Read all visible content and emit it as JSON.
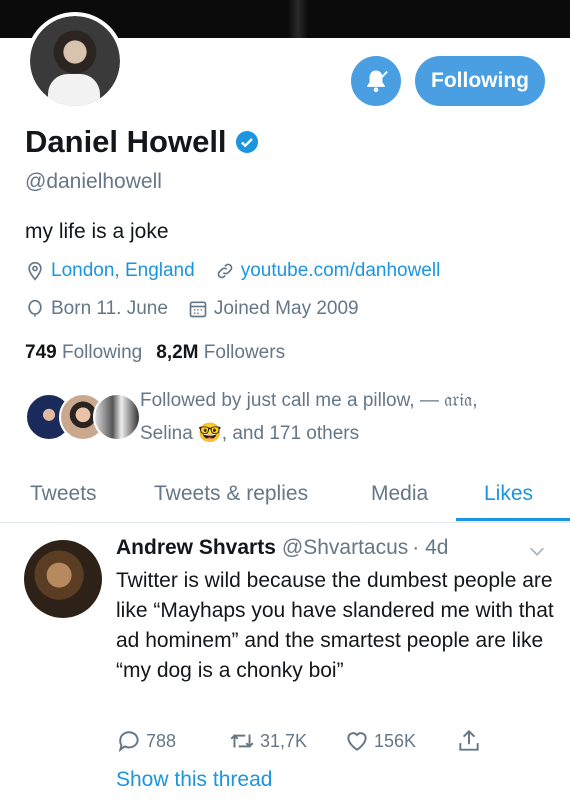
{
  "profile": {
    "name": "Daniel Howell",
    "handle": "@danielhowell",
    "bio": "my life is a joke",
    "location": "London, England",
    "website": "youtube.com/danhowell",
    "born": "Born 11. June",
    "joined": "Joined May 2009"
  },
  "header": {
    "follow_label": "Following"
  },
  "stats": {
    "following_count": "749",
    "following_label": "Following",
    "followers_count": "8,2M",
    "followers_label": "Followers"
  },
  "followed_by": {
    "line1": "Followed by just call me a pillow, — 𝔞𝔯𝔦𝔞,",
    "name": "Selina",
    "emoji": "🤓",
    "rest": ", and 171 others"
  },
  "tabs": [
    {
      "label": "Tweets"
    },
    {
      "label": "Tweets & replies"
    },
    {
      "label": "Media"
    },
    {
      "label": "Likes"
    }
  ],
  "tweet": {
    "author": "Andrew Shvarts",
    "handle": "@Shvartacus",
    "time": "· 4d",
    "text": "Twitter is wild because the dumbest people are like “Mayhaps you have slandered me with that ad hominem” and the smartest people are like “my dog is a chonky boi”",
    "replies": "788",
    "retweets": "31,7K",
    "likes": "156K",
    "thread_link": "Show this thread"
  },
  "colors": {
    "accent": "#1b95e0",
    "button": "#4a9fe3",
    "muted": "#657786"
  }
}
